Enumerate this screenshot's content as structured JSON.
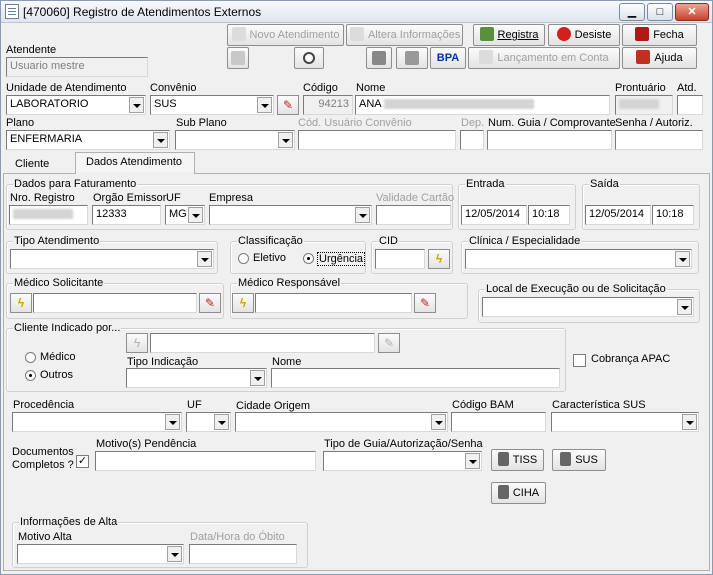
{
  "window": {
    "title": "[470060] Registro de Atendimentos Externos",
    "minimize": "▁",
    "maximize": "□",
    "close": "✕"
  },
  "toolbar": {
    "novo": "Novo Atendimento",
    "altera": "Altera Informações",
    "registra": "Registra",
    "desiste": "Desiste",
    "fecha": "Fecha",
    "bpa": "BPA",
    "lancamento": "Lançamento em Conta",
    "ajuda": "Ajuda"
  },
  "atendente": {
    "label": "Atendente",
    "value": "Usuario mestre"
  },
  "header": {
    "unidade_label": "Unidade de Atendimento",
    "unidade_value": "LABORATORIO",
    "convenio_label": "Convênio",
    "convenio_value": "SUS",
    "codigo_label": "Código",
    "codigo_value": "94213",
    "nome_label": "Nome",
    "nome_value": "ANA",
    "prontuario_label": "Prontuário",
    "atd_label": "Atd.",
    "plano_label": "Plano",
    "plano_value": "ENFERMARIA",
    "subplano_label": "Sub Plano",
    "codusuario_label": "Cód. Usuário Convênio",
    "dep_label": "Dep.",
    "numguia_label": "Num. Guia / Comprovante",
    "senha_label": "Senha / Autoriz."
  },
  "tabs": {
    "cliente": "Cliente",
    "dados": "Dados Atendimento"
  },
  "faturamento": {
    "title": "Dados para Faturamento",
    "nro_label": "Nro. Registro",
    "orgao_label": "Orgão Emissor",
    "orgao_value": "12333",
    "uf_label": "UF",
    "uf_value": "MG",
    "empresa_label": "Empresa",
    "validade_label": "Validade Cartão"
  },
  "entrada": {
    "title": "Entrada",
    "date": "12/05/2014",
    "time": "10:18"
  },
  "saida": {
    "title": "Saída",
    "date": "12/05/2014",
    "time": "10:18"
  },
  "tipo_atendimento": {
    "title": "Tipo Atendimento"
  },
  "classificacao": {
    "title": "Classificação",
    "eletivo": "Eletivo",
    "urgencia": "Urgência"
  },
  "cid": {
    "title": "CID"
  },
  "clinica": {
    "title": "Clínica / Especialidade"
  },
  "medico_solicitante": {
    "title": "Médico Solicitante"
  },
  "medico_responsavel": {
    "title": "Médico Responsável"
  },
  "local_execucao": {
    "title": "Local de Execução ou de Solicitação"
  },
  "cliente_indicado": {
    "title": "Cliente Indicado por...",
    "medico": "Médico",
    "outros": "Outros",
    "tipo_label": "Tipo Indicação",
    "nome_label": "Nome"
  },
  "cobranca": {
    "label": "Cobrança APAC"
  },
  "procedencia": {
    "label": "Procedência",
    "uf_label": "UF",
    "cidade_label": "Cidade Origem",
    "codbam_label": "Código BAM",
    "caract_label": "Característica SUS"
  },
  "documentos": {
    "label1": "Documentos",
    "label2": "Completos ?",
    "check": "✓",
    "motivo_label": "Motivo(s) Pendência",
    "tipoguia_label": "Tipo de Guia/Autorização/Senha"
  },
  "guias": {
    "tiss": "TISS",
    "sus": "SUS",
    "ciha": "CIHA"
  },
  "alta": {
    "title": "Informações de Alta",
    "motivo_label": "Motivo Alta",
    "obito_label": "Data/Hora do Óbito"
  },
  "colors": {
    "accent": "#0055cc",
    "bpa": "#0033aa"
  }
}
